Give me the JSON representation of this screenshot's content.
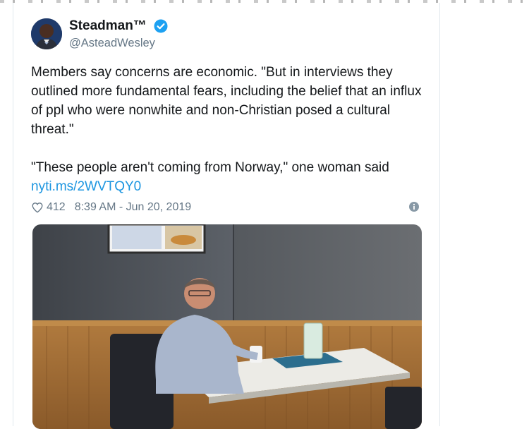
{
  "tweet": {
    "author_name": "Steadman™",
    "author_handle": "@AsteadWesley",
    "verified_icon": "verified-badge-icon",
    "text_paragraph_1": "Members say concerns are economic. \"But in interviews they outlined more fundamental fears, including the belief that an influx of ppl who were nonwhite and non-Christian posed a cultural threat.\"",
    "text_paragraph_2": "\"These people aren't coming from Norway,\" one woman said",
    "link_text": "nyti.ms/2WVTQY0",
    "like_count": "412",
    "timestamp": "8:39 AM - Jun 20, 2019",
    "like_icon": "heart-icon",
    "info_icon": "info-icon"
  },
  "colors": {
    "link_blue": "#1b95e0",
    "verified_blue": "#1da1f2",
    "meta_gray": "#657786",
    "text_dark": "#14171a"
  }
}
